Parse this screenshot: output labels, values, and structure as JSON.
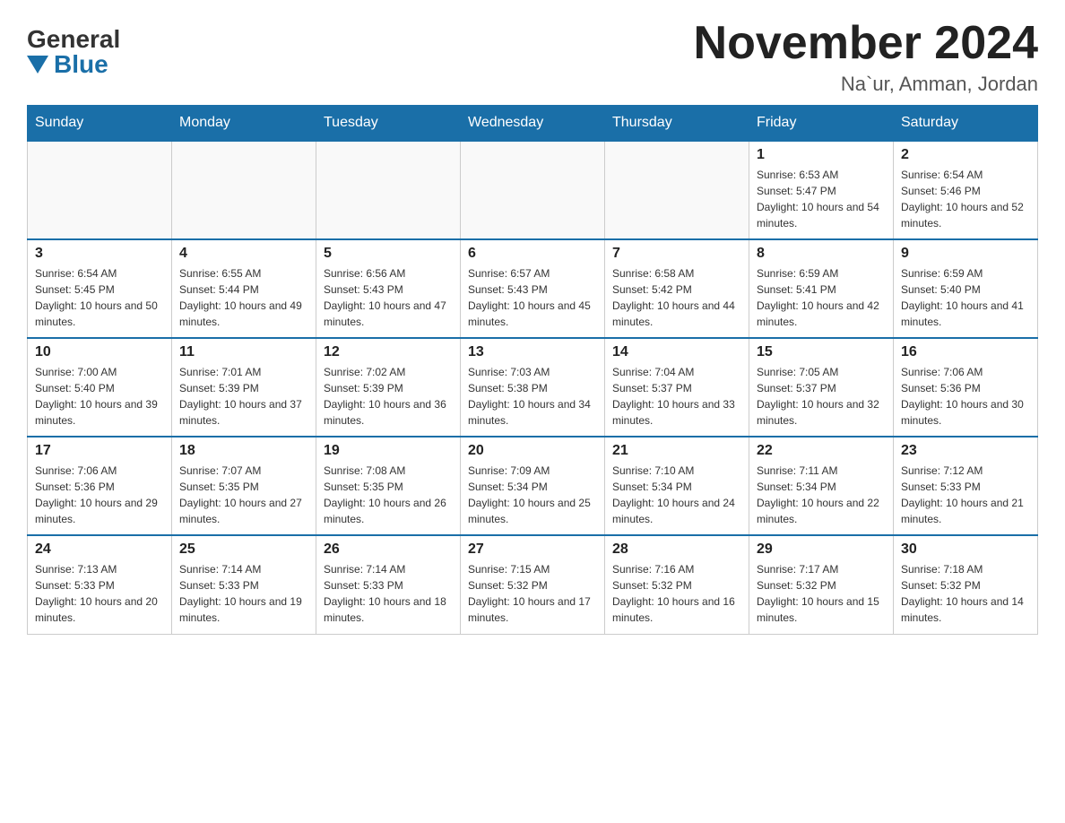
{
  "header": {
    "logo_general": "General",
    "logo_blue": "Blue",
    "month_title": "November 2024",
    "location": "Na`ur, Amman, Jordan"
  },
  "weekdays": [
    "Sunday",
    "Monday",
    "Tuesday",
    "Wednesday",
    "Thursday",
    "Friday",
    "Saturday"
  ],
  "weeks": [
    [
      {
        "day": "",
        "info": ""
      },
      {
        "day": "",
        "info": ""
      },
      {
        "day": "",
        "info": ""
      },
      {
        "day": "",
        "info": ""
      },
      {
        "day": "",
        "info": ""
      },
      {
        "day": "1",
        "info": "Sunrise: 6:53 AM\nSunset: 5:47 PM\nDaylight: 10 hours and 54 minutes."
      },
      {
        "day": "2",
        "info": "Sunrise: 6:54 AM\nSunset: 5:46 PM\nDaylight: 10 hours and 52 minutes."
      }
    ],
    [
      {
        "day": "3",
        "info": "Sunrise: 6:54 AM\nSunset: 5:45 PM\nDaylight: 10 hours and 50 minutes."
      },
      {
        "day": "4",
        "info": "Sunrise: 6:55 AM\nSunset: 5:44 PM\nDaylight: 10 hours and 49 minutes."
      },
      {
        "day": "5",
        "info": "Sunrise: 6:56 AM\nSunset: 5:43 PM\nDaylight: 10 hours and 47 minutes."
      },
      {
        "day": "6",
        "info": "Sunrise: 6:57 AM\nSunset: 5:43 PM\nDaylight: 10 hours and 45 minutes."
      },
      {
        "day": "7",
        "info": "Sunrise: 6:58 AM\nSunset: 5:42 PM\nDaylight: 10 hours and 44 minutes."
      },
      {
        "day": "8",
        "info": "Sunrise: 6:59 AM\nSunset: 5:41 PM\nDaylight: 10 hours and 42 minutes."
      },
      {
        "day": "9",
        "info": "Sunrise: 6:59 AM\nSunset: 5:40 PM\nDaylight: 10 hours and 41 minutes."
      }
    ],
    [
      {
        "day": "10",
        "info": "Sunrise: 7:00 AM\nSunset: 5:40 PM\nDaylight: 10 hours and 39 minutes."
      },
      {
        "day": "11",
        "info": "Sunrise: 7:01 AM\nSunset: 5:39 PM\nDaylight: 10 hours and 37 minutes."
      },
      {
        "day": "12",
        "info": "Sunrise: 7:02 AM\nSunset: 5:39 PM\nDaylight: 10 hours and 36 minutes."
      },
      {
        "day": "13",
        "info": "Sunrise: 7:03 AM\nSunset: 5:38 PM\nDaylight: 10 hours and 34 minutes."
      },
      {
        "day": "14",
        "info": "Sunrise: 7:04 AM\nSunset: 5:37 PM\nDaylight: 10 hours and 33 minutes."
      },
      {
        "day": "15",
        "info": "Sunrise: 7:05 AM\nSunset: 5:37 PM\nDaylight: 10 hours and 32 minutes."
      },
      {
        "day": "16",
        "info": "Sunrise: 7:06 AM\nSunset: 5:36 PM\nDaylight: 10 hours and 30 minutes."
      }
    ],
    [
      {
        "day": "17",
        "info": "Sunrise: 7:06 AM\nSunset: 5:36 PM\nDaylight: 10 hours and 29 minutes."
      },
      {
        "day": "18",
        "info": "Sunrise: 7:07 AM\nSunset: 5:35 PM\nDaylight: 10 hours and 27 minutes."
      },
      {
        "day": "19",
        "info": "Sunrise: 7:08 AM\nSunset: 5:35 PM\nDaylight: 10 hours and 26 minutes."
      },
      {
        "day": "20",
        "info": "Sunrise: 7:09 AM\nSunset: 5:34 PM\nDaylight: 10 hours and 25 minutes."
      },
      {
        "day": "21",
        "info": "Sunrise: 7:10 AM\nSunset: 5:34 PM\nDaylight: 10 hours and 24 minutes."
      },
      {
        "day": "22",
        "info": "Sunrise: 7:11 AM\nSunset: 5:34 PM\nDaylight: 10 hours and 22 minutes."
      },
      {
        "day": "23",
        "info": "Sunrise: 7:12 AM\nSunset: 5:33 PM\nDaylight: 10 hours and 21 minutes."
      }
    ],
    [
      {
        "day": "24",
        "info": "Sunrise: 7:13 AM\nSunset: 5:33 PM\nDaylight: 10 hours and 20 minutes."
      },
      {
        "day": "25",
        "info": "Sunrise: 7:14 AM\nSunset: 5:33 PM\nDaylight: 10 hours and 19 minutes."
      },
      {
        "day": "26",
        "info": "Sunrise: 7:14 AM\nSunset: 5:33 PM\nDaylight: 10 hours and 18 minutes."
      },
      {
        "day": "27",
        "info": "Sunrise: 7:15 AM\nSunset: 5:32 PM\nDaylight: 10 hours and 17 minutes."
      },
      {
        "day": "28",
        "info": "Sunrise: 7:16 AM\nSunset: 5:32 PM\nDaylight: 10 hours and 16 minutes."
      },
      {
        "day": "29",
        "info": "Sunrise: 7:17 AM\nSunset: 5:32 PM\nDaylight: 10 hours and 15 minutes."
      },
      {
        "day": "30",
        "info": "Sunrise: 7:18 AM\nSunset: 5:32 PM\nDaylight: 10 hours and 14 minutes."
      }
    ]
  ]
}
